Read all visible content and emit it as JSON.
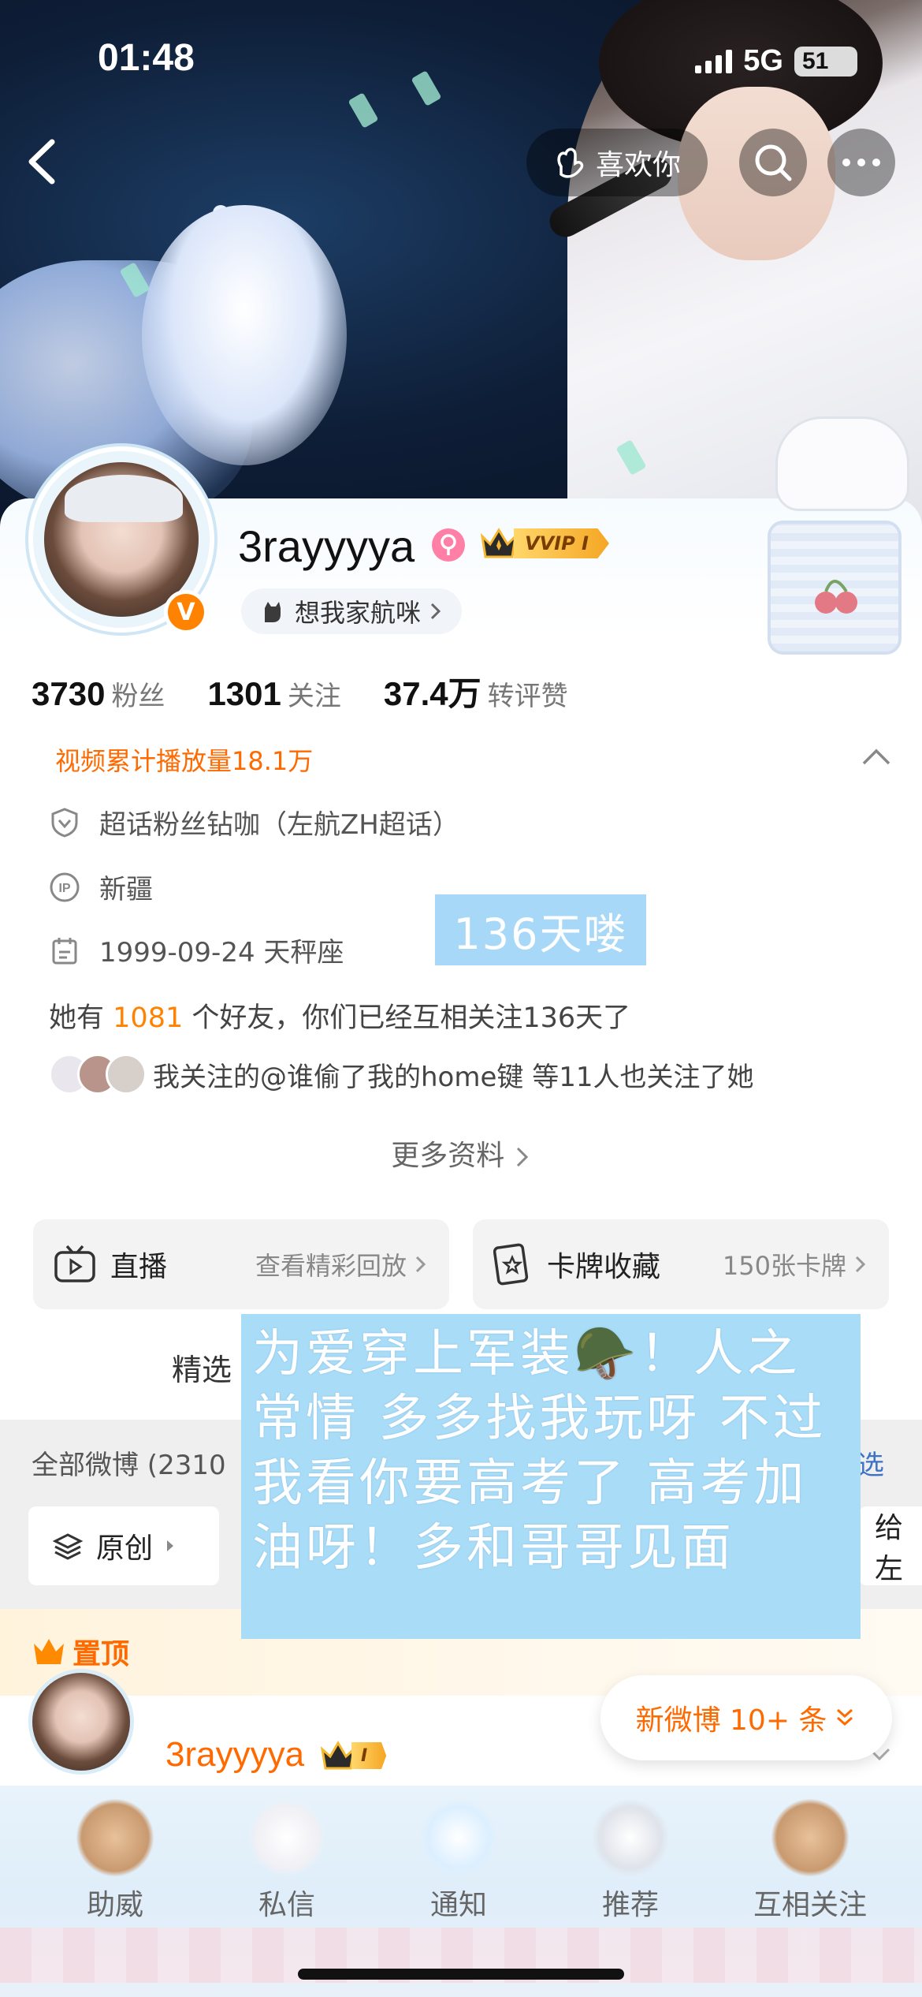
{
  "status_bar": {
    "time": "01:48",
    "network": "5G",
    "battery": "51"
  },
  "header": {
    "like_label": "喜欢你"
  },
  "profile": {
    "username": "3rayyyya",
    "vip_label": "VVIP I",
    "group_label": "想我家航咪",
    "stats": [
      {
        "value": "3730",
        "label": "粉丝"
      },
      {
        "value": "1301",
        "label": "关注"
      },
      {
        "value": "37.4万",
        "label": "转评赞"
      }
    ],
    "video_plays": "视频累计播放量18.1万",
    "info": {
      "supertopic": "超话粉丝钻咖（左航ZH超话）",
      "ip": "新疆",
      "birthday": "1999-09-24 天秤座"
    },
    "friends_prefix": "她有",
    "friends_count": "1081",
    "friends_suffix": "个好友，你们已经互相关注136天了",
    "mutual_follow_text": "我关注的@谁偷了我的home键 等11人也关注了她",
    "more_info": "更多资料"
  },
  "sticker_note": "136天喽",
  "tiles": [
    {
      "title": "直播",
      "sub": "查看精彩回放"
    },
    {
      "title": "卡牌收藏",
      "sub": "150张卡牌"
    }
  ],
  "tabs": {
    "selected": "精选"
  },
  "feed": {
    "all_label": "全部微博 (2310",
    "filter_label": "选",
    "chips": [
      "原创",
      "给左"
    ],
    "sticky_label": "置顶",
    "post_author": "3rayyyya",
    "post_vip": "I",
    "new_posts": "新微博 10+ 条"
  },
  "overlay_note": "为爱穿上军装🪖！人之常情 多多找我玩呀 不过我看你要高考了 高考加油呀！多和哥哥见面",
  "bottom_nav": [
    {
      "label": "助威"
    },
    {
      "label": "私信"
    },
    {
      "label": "通知"
    },
    {
      "label": "推荐"
    },
    {
      "label": "互相关注"
    }
  ],
  "colors": {
    "accent": "#ff8200",
    "orange_text": "#ff6a00",
    "note_bg": "#a9dcf7"
  }
}
